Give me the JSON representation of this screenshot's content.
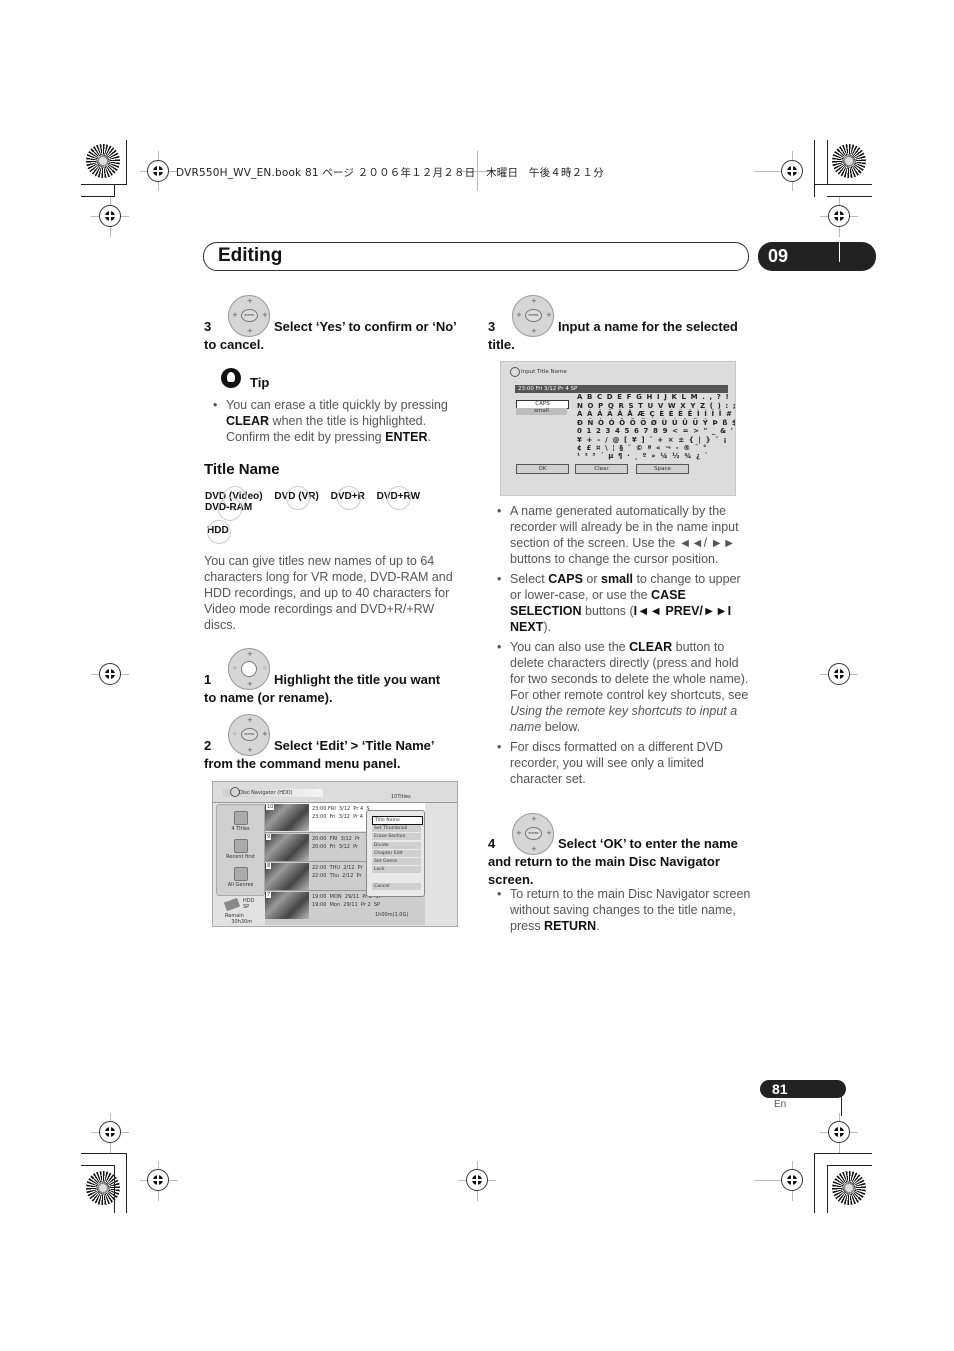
{
  "print_header": {
    "text": "DVR550H_WV_EN.book  81 ページ  ２００６年１２月２８日　木曜日　午後４時２１分"
  },
  "chapter": {
    "title": "Editing",
    "number": "09"
  },
  "left_column": {
    "step3": {
      "number": "3",
      "text_line1": "Select ‘Yes’ to confirm or ‘No’",
      "text_line2": "to cancel."
    },
    "tip": {
      "label": "Tip",
      "parts": [
        {
          "t": "You can erase a title quickly by pressing ",
          "b": false
        },
        {
          "t": "CLEAR",
          "b": true
        },
        {
          "t": " when the title is highlighted. Confirm the edit by pressing ",
          "b": false
        },
        {
          "t": "ENTER",
          "b": true
        },
        {
          "t": ".",
          "b": false
        }
      ]
    },
    "section_title": "Title Name",
    "disc_badges": [
      "DVD (Video)",
      "DVD (VR)",
      "DVD+R",
      "DVD+RW",
      "DVD-RAM",
      "HDD"
    ],
    "intro": "You can give titles new names of up to 64 characters long for VR mode, DVD-RAM and HDD recordings, and up to 40 characters for Video mode recordings and DVD+R/+RW discs.",
    "step1": {
      "number": "1",
      "text_line1": "Highlight the title you want",
      "text_line2": "to name (or rename)."
    },
    "step2": {
      "number": "2",
      "text_line1": "Select ‘Edit’ > ‘Title Name’",
      "text_line2": "from the command menu panel."
    }
  },
  "disc_navigator_screen": {
    "title": "Disc Navigator (HDD)",
    "count": "10Titles",
    "left_panel": [
      "4 Titles",
      "Recent first",
      "All Genres"
    ],
    "storage": {
      "type": "HDD",
      "mode": "SP",
      "remain_label": "Remain",
      "remain_value": "30h30m"
    },
    "rows": [
      {
        "num": "10",
        "line1": "23:00 FRI  3/12  Pr 4  S",
        "line2": "23:00  Fri  3/12  Pr 4"
      },
      {
        "num": "9",
        "line1": "20:00  FRI  3/12  Pr",
        "line2": "20:00  Fri  3/12  Pr"
      },
      {
        "num": "8",
        "line1": "22:00  THU  2/12  Pr",
        "line2": "22:00  Thu  2/12  Pr"
      },
      {
        "num": "7",
        "line1": "19:00  MON  29/11  Pr 2  SP",
        "line2": "19:00  Mon  29/11  Pr 2  SP"
      }
    ],
    "duration": "1h00m(1.0G)",
    "command_menu": [
      "Title Name",
      "Set Thumbnail",
      "Erase Section",
      "Divide",
      "Chapter Edit",
      "Set Genre",
      "Lock",
      "Cancel"
    ],
    "selected_menu_item": "Title Name"
  },
  "right_column": {
    "step3": {
      "number": "3",
      "text_line1": "Input a name for the selected",
      "text_line2": "title."
    },
    "bullets": [
      {
        "parts": [
          {
            "t": "A name generated automatically by the recorder will already be in the name input section of the screen. Use the ◄◄/ ►► buttons to change the cursor position.",
            "b": false,
            "i": false
          }
        ]
      },
      {
        "parts": [
          {
            "t": "Select ",
            "b": false
          },
          {
            "t": "CAPS",
            "b": true
          },
          {
            "t": " or ",
            "b": false
          },
          {
            "t": "small",
            "b": true
          },
          {
            "t": " to change to upper or lower-case, or use the ",
            "b": false
          },
          {
            "t": "CASE SELECTION",
            "b": true
          },
          {
            "t": " buttons (",
            "b": false
          },
          {
            "t": "I◄◄ PREV/►►I NEXT",
            "b": true
          },
          {
            "t": ").",
            "b": false
          }
        ]
      },
      {
        "parts": [
          {
            "t": "You can also use the ",
            "b": false
          },
          {
            "t": "CLEAR",
            "b": true
          },
          {
            "t": " button to delete characters directly (press and hold for two seconds to delete the whole name). For other remote control key shortcuts, see ",
            "b": false
          },
          {
            "t": "Using the remote key shortcuts to input a name",
            "i": true
          },
          {
            "t": " below.",
            "b": false
          }
        ]
      },
      {
        "parts": [
          {
            "t": "For discs formatted on a different DVD recorder, you will see only a limited character set.",
            "b": false
          }
        ]
      }
    ],
    "step4": {
      "number": "4",
      "text_line1": "Select ‘OK’ to enter the name",
      "text_line2": "and return to the main Disc Navigator",
      "text_line3": "screen."
    },
    "step4_bullet": [
      {
        "t": "To return to the main Disc Navigator screen without saving changes to the title name, press ",
        "b": false
      },
      {
        "t": "RETURN",
        "b": true
      },
      {
        "t": ".",
        "b": false
      }
    ]
  },
  "input_title_screen": {
    "title": "Input Title Name",
    "current_name": "23:00  Fri  3/12  Pr 4   SP",
    "case_options": [
      "CAPS",
      "small"
    ],
    "selected_case": "CAPS",
    "char_rows": [
      "A B C D E F G H I J K L M . , ? !",
      "N O P Q R S T U V W X Y Z ( ) : ;",
      "À Á Â Ã Ä Å Æ Ç È É Ê Ë Ì Í Î Ï #",
      "Ð Ñ Ò Ó Ô Õ Ö Ø Ù Ú Û Ü Ý Þ ß $ %",
      "0 1 2 3 4 5 6 7 8 9 < = > \" _ & '",
      "¥ + – / @ [ ¥ ] ˆ + × ± { | } ˜ ¡",
      "¢ £ ¤ \\ ¦ § ¨ © ª « ¬ - ® ¯ °",
      "¹ ² ³ ´ µ ¶ · ¸ º » ¼ ½ ¾ ¿ `"
    ],
    "buttons": [
      "OK",
      "Clear",
      "Space"
    ]
  },
  "footer": {
    "page_number": "81",
    "language": "En"
  }
}
